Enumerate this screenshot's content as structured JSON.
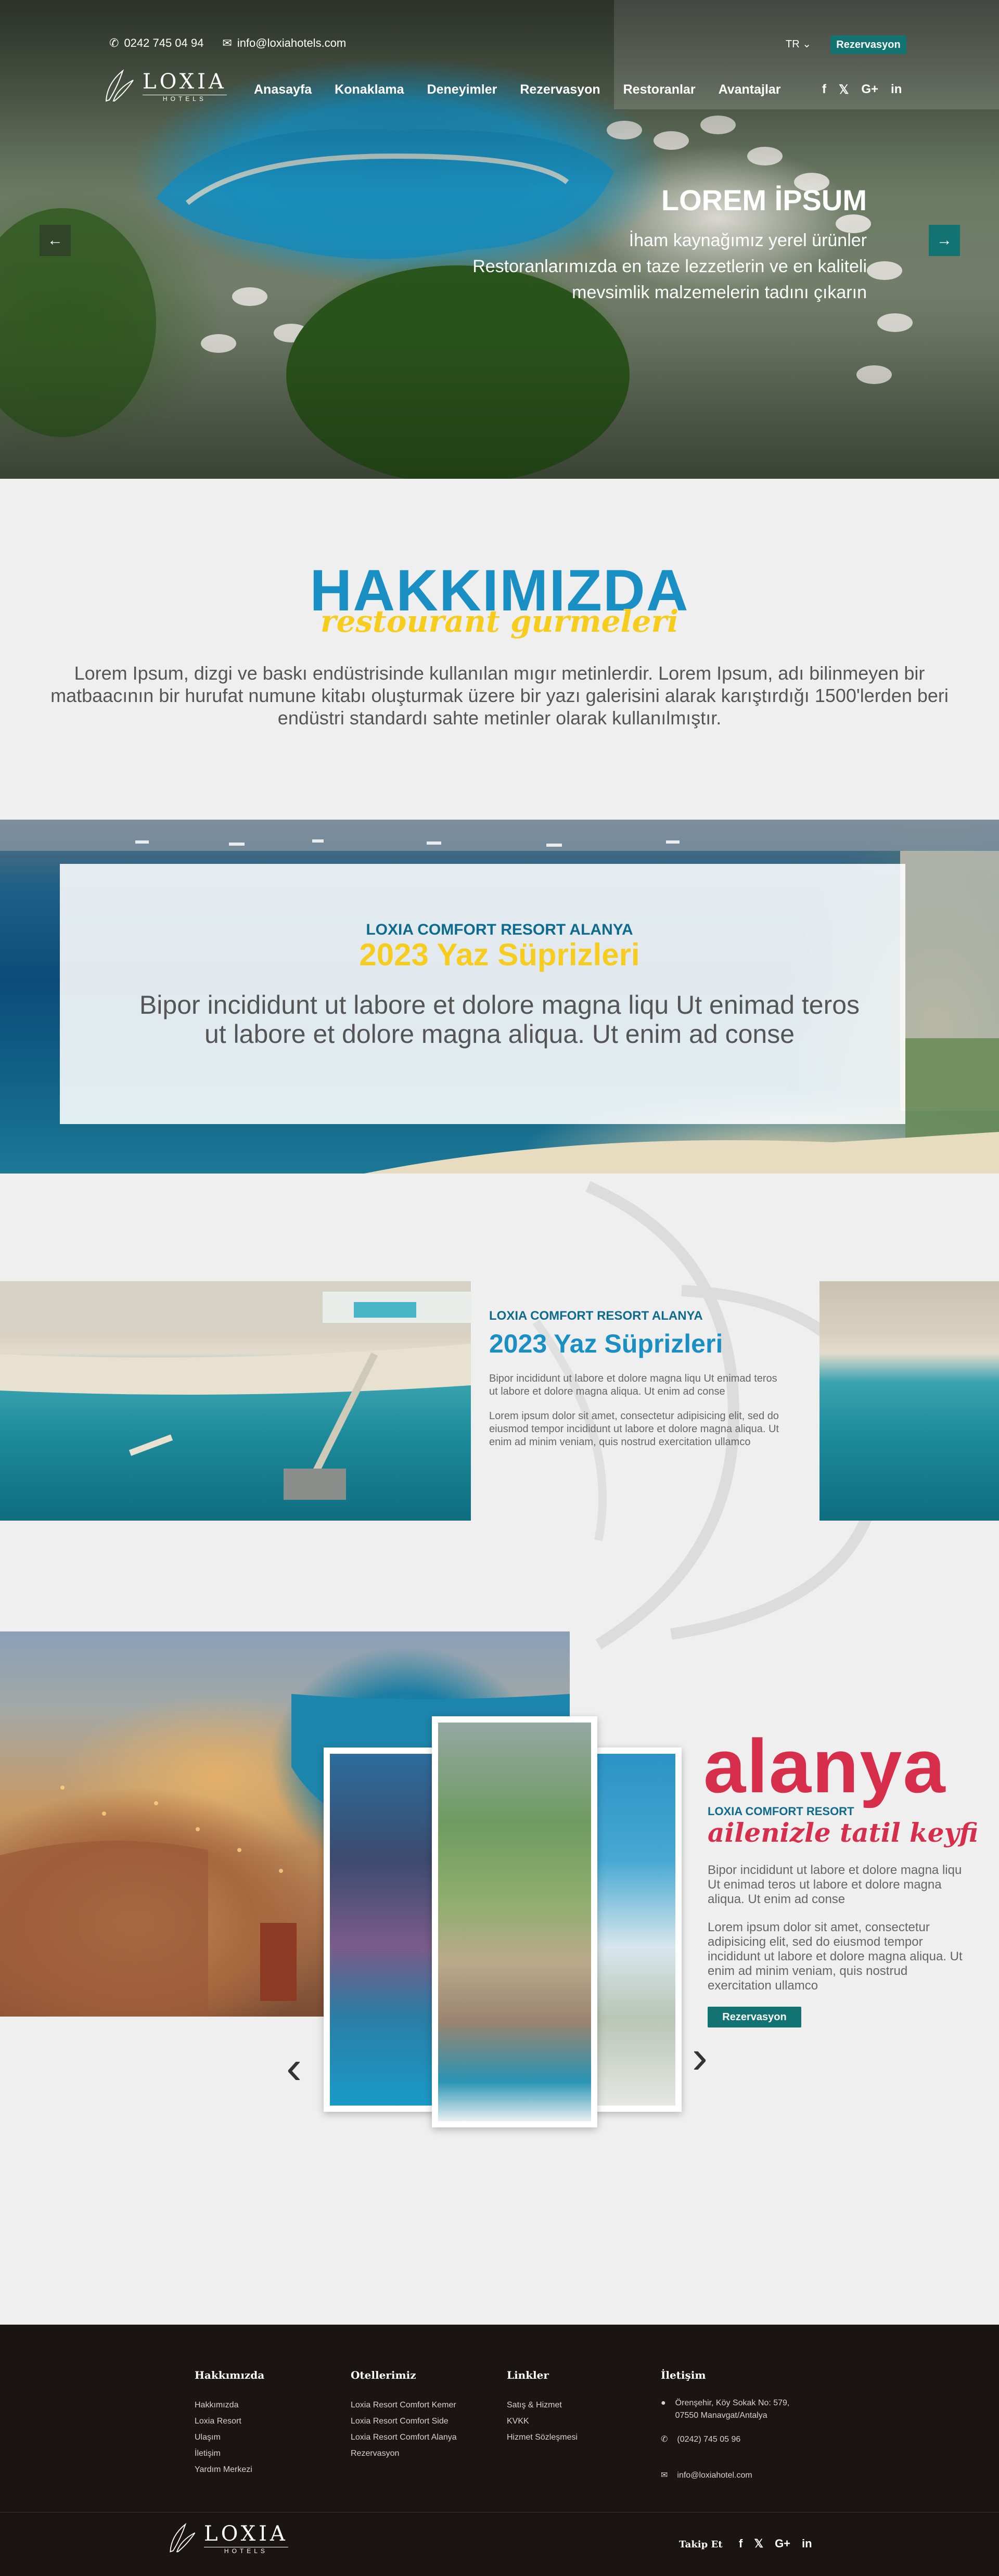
{
  "colors": {
    "accent_teal": "#137373",
    "brand_blue": "#1a8fc4",
    "yellow": "#f6cc1e",
    "red": "#d62e4b",
    "footer_bg": "#1a1512"
  },
  "topbar": {
    "phone": "0242 745 04 94",
    "email": "info@loxiahotels.com",
    "language": "TR",
    "reservation_button": "Rezervasyon"
  },
  "logo": {
    "name": "LOXIA",
    "sub": "HOTELS"
  },
  "nav": {
    "items": [
      "Anasayfa",
      "Konaklama",
      "Deneyimler",
      "Rezervasyon",
      "Restoranlar",
      "Avantajlar"
    ]
  },
  "social": {
    "icons": [
      "facebook-icon",
      "twitter-icon",
      "google-plus-icon",
      "linkedin-icon"
    ],
    "labels": [
      "f",
      "𝕏",
      "G+",
      "in"
    ]
  },
  "hero": {
    "title": "LOREM İPSUM",
    "lines": [
      "İham kaynağımız yerel ürünler",
      "Restoranlarımızda en taze lezzetlerin ve en kaliteli",
      "mevsimlik malzemelerin tadını çıkarın"
    ],
    "prev": "←",
    "next": "→"
  },
  "about": {
    "title": "HAKKIMIZDA",
    "script": "restourant gurmeleri",
    "text": "Lorem Ipsum, dizgi ve baskı endüstrisinde kullanılan mıgır metinlerdir. Lorem Ipsum, adı bilinmeyen bir matbaacının bir hurufat numune kitabı oluşturmak üzere bir yazı galerisini alarak karıştırdığı 1500'lerden beri endüstri standardı sahte metinler olarak kullanılmıştır."
  },
  "banner": {
    "kicker": "LOXIA COMFORT RESORT ALANYA",
    "title": "2023 Yaz Süprizleri",
    "text_line1": "Bipor incididunt ut labore et dolore magna liqu Ut enimad teros",
    "text_line2": "ut labore et dolore magna aliqua. Ut enim ad conse"
  },
  "promo": {
    "kicker": "LOXIA COMFORT RESORT ALANYA",
    "title": "2023 Yaz Süprizleri",
    "p1": "Bipor incididunt ut labore et dolore magna liqu Ut enimad teros ut labore et dolore magna aliqua. Ut enim ad conse",
    "p2": "Lorem ipsum dolor sit amet, consectetur adipisicing elit, sed do eiusmod tempor incididunt ut labore et dolore magna aliqua. Ut enim ad minim veniam, quis nostrud exercitation ullamco"
  },
  "alanya": {
    "word": "alanya",
    "kicker": "LOXIA COMFORT RESORT",
    "script": "ailenizle tatil keyfi",
    "p1": "Bipor incididunt ut labore et dolore magna liqu Ut enimad teros ut labore et dolore magna aliqua. Ut enim ad conse",
    "p2": "Lorem ipsum dolor sit amet, consectetur adipisicing elit, sed do eiusmod tempor incididunt ut labore et dolore magna aliqua. Ut enim ad minim veniam, quis nostrud exercitation ullamco",
    "button": "Rezervasyon",
    "prev": "‹",
    "next": "›"
  },
  "footer": {
    "col1": {
      "title": "Hakkımızda",
      "items": [
        "Hakkımızda",
        "Loxia Resort",
        "Ulaşım",
        "İletişim",
        "Yardım Merkezi"
      ]
    },
    "col2": {
      "title": "Otellerimiz",
      "items": [
        "Loxia Resort Comfort Kemer",
        "Loxia Resort Comfort Side",
        "Loxia Resort Comfort Alanya",
        "Rezervasyon"
      ]
    },
    "col3": {
      "title": "Linkler",
      "items": [
        "Satış & Hizmet",
        "KVKK",
        "Hizmet Sözleşmesi"
      ]
    },
    "col4": {
      "title": "İletişim",
      "address1": "Örenşehir, Köy Sokak No: 579,",
      "address2": "07550 Manavgat/Antalya",
      "phone": "(0242) 745 05 96",
      "email": "info@loxiahotel.com"
    },
    "follow": "Takip Et"
  }
}
